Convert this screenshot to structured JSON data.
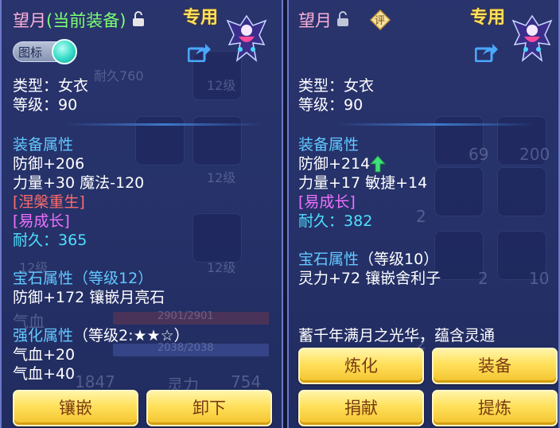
{
  "left": {
    "item_name": "望月",
    "equip_status": "(当前装备)",
    "special_tag": "专用",
    "toggle_label": "图标",
    "type_line": "类型：女衣",
    "level_line": "等级：90",
    "equip_attr_title": "装备属性",
    "attr_lines": [
      "防御+206",
      "力量+30 魔法-120"
    ],
    "special_effect": "[涅槃重生]",
    "special_skill": "[易成长]",
    "durability_label": "耐久：",
    "durability_value": "365",
    "gem_title": "宝石属性",
    "gem_level": "（等级12）",
    "gem_line": "防御+172 镶嵌月亮石",
    "enhance_title": "强化属性",
    "enhance_level": "（等级2:★★☆）",
    "enhance_lines": [
      "气血+20",
      "气血+40"
    ],
    "buttons": [
      "镶嵌",
      "卸下"
    ],
    "background": {
      "levels": [
        "12级",
        "12级",
        "12级",
        "12级"
      ],
      "hp_bar": "2901/2901",
      "mp_bar": "2038/2038",
      "labels": [
        "耐久760",
        "气血",
        "灵力"
      ],
      "numbers": [
        "1847",
        "754"
      ]
    }
  },
  "right": {
    "item_name": "望月",
    "special_tag": "专用",
    "eval_label": "评",
    "type_line": "类型：女衣",
    "level_line": "等级：90",
    "equip_attr_title": "装备属性",
    "attr_lines": [
      "防御+214",
      "力量+17 敏捷+14"
    ],
    "special_skill": "[易成长]",
    "durability_label": "耐久：",
    "durability_value": "382",
    "gem_title": "宝石属性",
    "gem_level": "（等级10）",
    "gem_line": "灵力+72 镶嵌舍利子",
    "description": "蓄千年满月之光华，蕴含灵通",
    "buttons": [
      "炼化",
      "装备",
      "捐献",
      "提炼"
    ],
    "background": {
      "numbers": [
        "69",
        "200",
        "2",
        "2",
        "10",
        "2"
      ]
    }
  },
  "colors": {
    "name": "#ffb0d8",
    "equip_status": "#7cff73",
    "special": "#ffe15a",
    "section_title": "#62c8ff",
    "durability": "#4fe0ff",
    "effect": "#ff6b6b",
    "skill": "#f070ff",
    "button": "#ffe05a"
  },
  "icons": [
    "lock-icon",
    "share-icon",
    "toggle-switch",
    "portrait-icon",
    "eval-icon",
    "arrow-up-icon"
  ]
}
